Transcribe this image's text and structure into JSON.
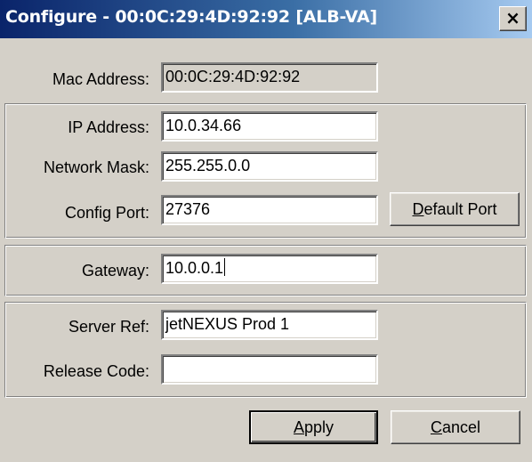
{
  "window": {
    "title": "Configure - 00:0C:29:4D:92:92 [ALB-VA]",
    "close_symbol": "×"
  },
  "mac": {
    "label": "Mac Address:",
    "value": "00:0C:29:4D:92:92"
  },
  "network": {
    "ip_label": "IP Address:",
    "ip_value": "10.0.34.66",
    "mask_label": "Network Mask:",
    "mask_value": "255.255.0.0",
    "port_label": "Config Port:",
    "port_value": "27376",
    "default_port_first": "D",
    "default_port_rest": "efault Port"
  },
  "gateway": {
    "label": "Gateway:",
    "value": "10.0.0.1"
  },
  "server": {
    "ref_label": "Server Ref:",
    "ref_value": "jetNEXUS Prod 1",
    "release_label": "Release Code:",
    "release_value": ""
  },
  "buttons": {
    "apply_first": "A",
    "apply_rest": "pply",
    "cancel_first": "C",
    "cancel_rest": "ancel"
  },
  "colors": {
    "dialog_bg": "#d4d0c8",
    "title_start": "#0a246a",
    "title_end": "#a6caf0"
  }
}
